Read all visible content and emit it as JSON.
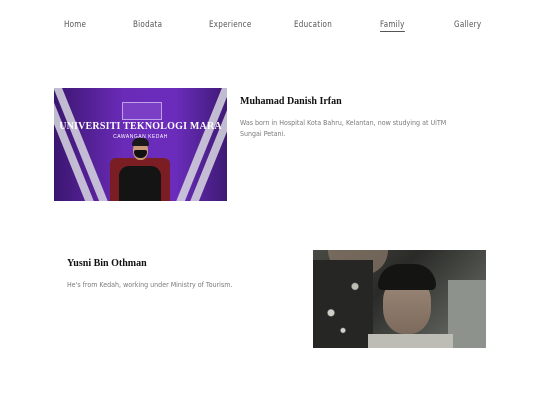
{
  "nav": {
    "items": [
      {
        "label": "Home"
      },
      {
        "label": "Biodata"
      },
      {
        "label": "Experience"
      },
      {
        "label": "Education"
      },
      {
        "label": "Family"
      },
      {
        "label": "Gallery"
      }
    ],
    "active": "Family"
  },
  "members": [
    {
      "name": "Muhamad Danish Irfan",
      "description": "Was born in Hospital Kota Bahru, Kelantan, now studying at UiTM Sungai Petani.",
      "photo": {
        "banner_title": "UNIVERSITI TEKNOLOGI MARA",
        "banner_subtitle": "CAWANGAN KEDAH"
      }
    },
    {
      "name": "Yusni Bin Othman",
      "description": "He's from Kedah, working under Ministry of Tourism."
    }
  ],
  "colors": {
    "banner_purple": "#6a2bb8",
    "nav_text": "#555555",
    "desc_text": "#7a7a7a"
  }
}
